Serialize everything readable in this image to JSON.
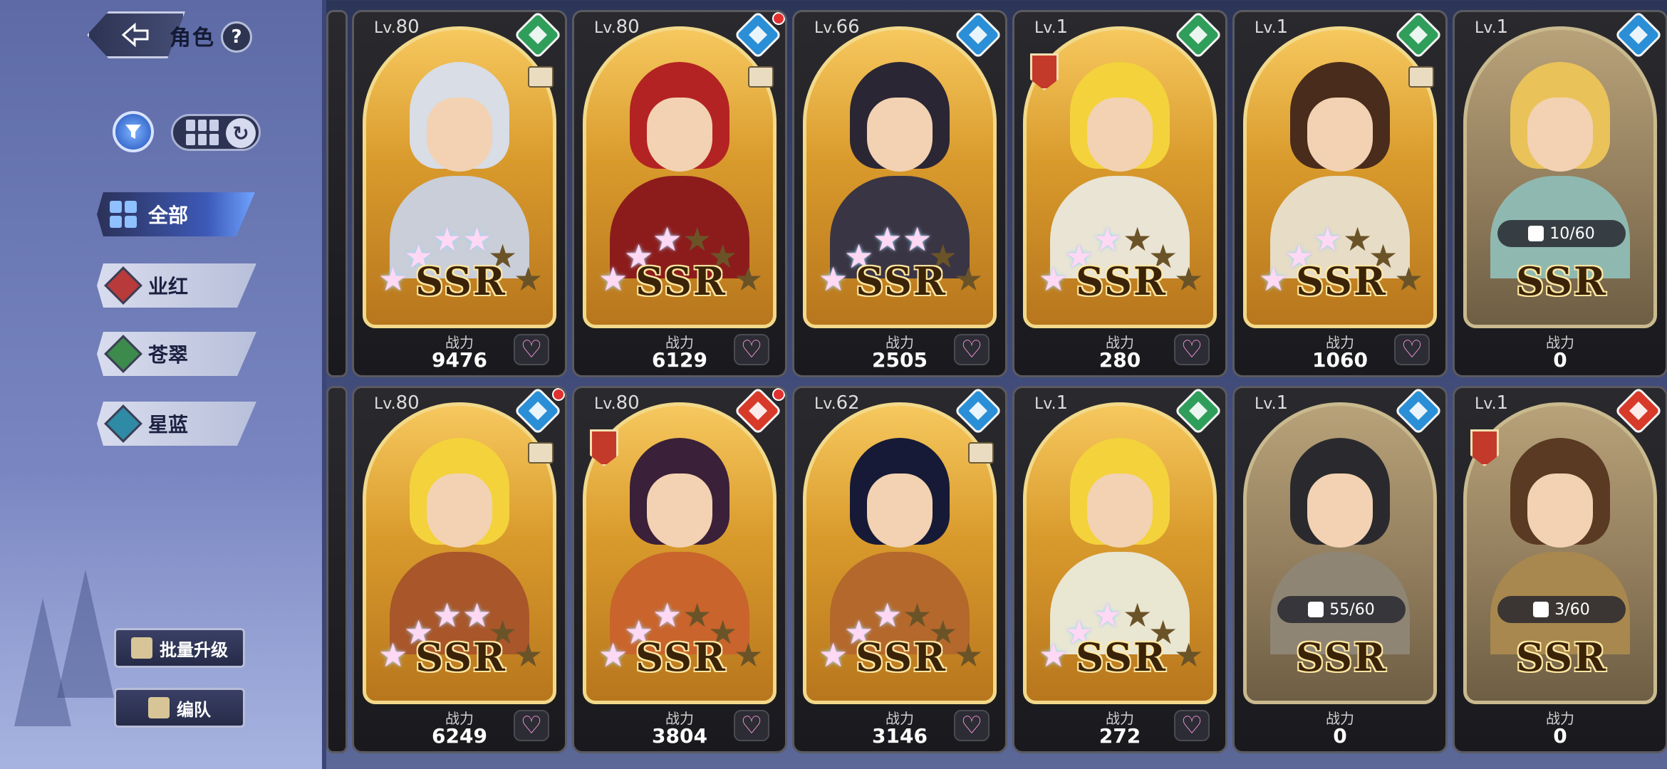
{
  "header": {
    "title": "角色",
    "help_label": "?"
  },
  "categories": [
    {
      "label": "全部",
      "color": "#6fa3ff"
    },
    {
      "label": "业红",
      "color": "#b83a3a"
    },
    {
      "label": "苍翠",
      "color": "#3c8a4c"
    },
    {
      "label": "星蓝",
      "color": "#2f8aa6"
    }
  ],
  "buttons": {
    "batch_upgrade": "批量升级",
    "team": "编队"
  },
  "power_label": "战力",
  "cards": [
    {
      "lv": "80",
      "element_color": "#2f9e5a",
      "stars": 4,
      "rarity": "SSR",
      "power": "9476",
      "notify": false,
      "shield": false,
      "ticket": true,
      "hair": "#d8dde6",
      "body": "#c9ced8",
      "dim": false,
      "shards": ""
    },
    {
      "lv": "80",
      "element_color": "#2a8fd6",
      "stars": 3,
      "rarity": "SSR",
      "power": "6129",
      "notify": true,
      "shield": false,
      "ticket": true,
      "hair": "#b32323",
      "body": "#8c1c1c",
      "dim": false,
      "shards": ""
    },
    {
      "lv": "66",
      "element_color": "#2a8fd6",
      "stars": 4,
      "rarity": "SSR",
      "power": "2505",
      "notify": false,
      "shield": false,
      "ticket": false,
      "hair": "#2b2634",
      "body": "#3a3544",
      "dim": false,
      "shards": ""
    },
    {
      "lv": "1",
      "element_color": "#2f9e5a",
      "stars": 3,
      "rarity": "SSR",
      "power": "280",
      "notify": false,
      "shield": true,
      "ticket": false,
      "hair": "#f4d23c",
      "body": "#e9e4d4",
      "dim": false,
      "shards": ""
    },
    {
      "lv": "1",
      "element_color": "#2f9e5a",
      "stars": 3,
      "rarity": "SSR",
      "power": "1060",
      "notify": false,
      "shield": false,
      "ticket": true,
      "hair": "#4a2c1c",
      "body": "#e7dcc6",
      "dim": false,
      "shards": ""
    },
    {
      "lv": "1",
      "element_color": "#2a8fd6",
      "stars": 0,
      "rarity": "SSR",
      "power": "0",
      "notify": false,
      "shield": false,
      "ticket": false,
      "hair": "#e9c25a",
      "body": "#8fb9b0",
      "dim": true,
      "shards": "10/60"
    },
    {
      "lv": "80",
      "element_color": "#2a8fd6",
      "stars": 4,
      "rarity": "SSR",
      "power": "6249",
      "notify": true,
      "shield": false,
      "ticket": true,
      "hair": "#f4d23c",
      "body": "#a8562a",
      "dim": false,
      "shards": ""
    },
    {
      "lv": "80",
      "element_color": "#d83a2a",
      "stars": 3,
      "rarity": "SSR",
      "power": "3804",
      "notify": true,
      "shield": true,
      "ticket": false,
      "hair": "#3a2038",
      "body": "#c8642c",
      "dim": false,
      "shards": ""
    },
    {
      "lv": "62",
      "element_color": "#2a8fd6",
      "stars": 3,
      "rarity": "SSR",
      "power": "3146",
      "notify": false,
      "shield": false,
      "ticket": true,
      "hair": "#161a36",
      "body": "#b4682c",
      "dim": false,
      "shards": ""
    },
    {
      "lv": "1",
      "element_color": "#2f9e5a",
      "stars": 3,
      "rarity": "SSR",
      "power": "272",
      "notify": false,
      "shield": false,
      "ticket": false,
      "hair": "#f4d23c",
      "body": "#e9e6d2",
      "dim": false,
      "shards": ""
    },
    {
      "lv": "1",
      "element_color": "#2a8fd6",
      "stars": 0,
      "rarity": "SSR",
      "power": "0",
      "notify": false,
      "shield": false,
      "ticket": false,
      "hair": "#2a2a2e",
      "body": "#8f8574",
      "dim": true,
      "shards": "55/60"
    },
    {
      "lv": "1",
      "element_color": "#d83a2a",
      "stars": 0,
      "rarity": "SSR",
      "power": "0",
      "notify": false,
      "shield": true,
      "ticket": false,
      "hair": "#5a3a22",
      "body": "#a8884e",
      "dim": true,
      "shards": "3/60"
    }
  ]
}
